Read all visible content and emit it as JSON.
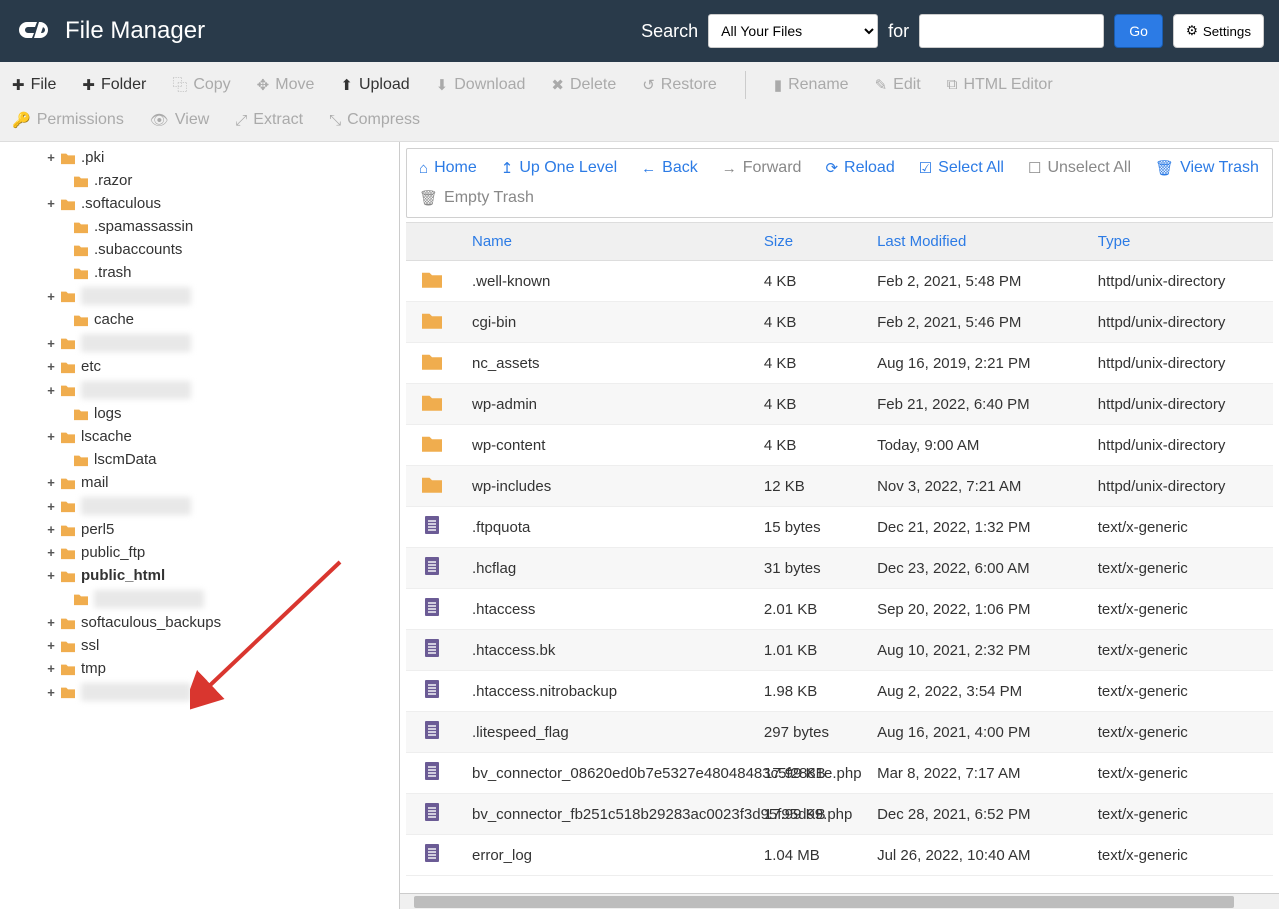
{
  "header": {
    "title": "File Manager",
    "search_label": "Search",
    "for_label": "for",
    "search_scope": "All Your Files",
    "go_label": "Go",
    "settings_label": "Settings"
  },
  "toolbar": {
    "file": "File",
    "folder": "Folder",
    "copy": "Copy",
    "move": "Move",
    "upload": "Upload",
    "download": "Download",
    "delete": "Delete",
    "restore": "Restore",
    "rename": "Rename",
    "edit": "Edit",
    "html_editor": "HTML Editor",
    "permissions": "Permissions",
    "view": "View",
    "extract": "Extract",
    "compress": "Compress"
  },
  "nav": {
    "home": "Home",
    "up": "Up One Level",
    "back": "Back",
    "forward": "Forward",
    "reload": "Reload",
    "select_all": "Select All",
    "unselect_all": "Unselect All",
    "view_trash": "View Trash",
    "empty_trash": "Empty Trash"
  },
  "tree": [
    {
      "toggle": "+",
      "label": ".pki",
      "level": 0
    },
    {
      "toggle": "",
      "label": ".razor",
      "level": 1
    },
    {
      "toggle": "+",
      "label": ".softaculous",
      "level": 0
    },
    {
      "toggle": "",
      "label": ".spamassassin",
      "level": 1
    },
    {
      "toggle": "",
      "label": ".subaccounts",
      "level": 1
    },
    {
      "toggle": "",
      "label": ".trash",
      "level": 1
    },
    {
      "toggle": "+",
      "label": "",
      "level": 0,
      "blurred": true
    },
    {
      "toggle": "",
      "label": "cache",
      "level": 1
    },
    {
      "toggle": "+",
      "label": "",
      "level": 0,
      "blurred": true
    },
    {
      "toggle": "+",
      "label": "etc",
      "level": 0
    },
    {
      "toggle": "+",
      "label": "",
      "level": 0,
      "blurred": true
    },
    {
      "toggle": "",
      "label": "logs",
      "level": 1
    },
    {
      "toggle": "+",
      "label": "lscache",
      "level": 0
    },
    {
      "toggle": "",
      "label": "lscmData",
      "level": 1
    },
    {
      "toggle": "+",
      "label": "mail",
      "level": 0
    },
    {
      "toggle": "+",
      "label": "",
      "level": 0,
      "blurred": true
    },
    {
      "toggle": "+",
      "label": "perl5",
      "level": 0
    },
    {
      "toggle": "+",
      "label": "public_ftp",
      "level": 0
    },
    {
      "toggle": "+",
      "label": "public_html",
      "level": 0,
      "bold": true
    },
    {
      "toggle": "",
      "label": "",
      "level": 1,
      "blurred": true
    },
    {
      "toggle": "+",
      "label": "softaculous_backups",
      "level": 0
    },
    {
      "toggle": "+",
      "label": "ssl",
      "level": 0
    },
    {
      "toggle": "+",
      "label": "tmp",
      "level": 0
    },
    {
      "toggle": "+",
      "label": "",
      "level": 0,
      "blurred": true
    }
  ],
  "columns": {
    "name": "Name",
    "size": "Size",
    "modified": "Last Modified",
    "type": "Type"
  },
  "files": [
    {
      "icon": "folder",
      "name": ".well-known",
      "size": "4 KB",
      "modified": "Feb 2, 2021, 5:48 PM",
      "type": "httpd/unix-directory"
    },
    {
      "icon": "folder",
      "name": "cgi-bin",
      "size": "4 KB",
      "modified": "Feb 2, 2021, 5:46 PM",
      "type": "httpd/unix-directory"
    },
    {
      "icon": "folder",
      "name": "nc_assets",
      "size": "4 KB",
      "modified": "Aug 16, 2019, 2:21 PM",
      "type": "httpd/unix-directory"
    },
    {
      "icon": "folder",
      "name": "wp-admin",
      "size": "4 KB",
      "modified": "Feb 21, 2022, 6:40 PM",
      "type": "httpd/unix-directory"
    },
    {
      "icon": "folder",
      "name": "wp-content",
      "size": "4 KB",
      "modified": "Today, 9:00 AM",
      "type": "httpd/unix-directory"
    },
    {
      "icon": "folder",
      "name": "wp-includes",
      "size": "12 KB",
      "modified": "Nov 3, 2022, 7:21 AM",
      "type": "httpd/unix-directory"
    },
    {
      "icon": "file",
      "name": ".ftpquota",
      "size": "15 bytes",
      "modified": "Dec 21, 2022, 1:32 PM",
      "type": "text/x-generic"
    },
    {
      "icon": "file",
      "name": ".hcflag",
      "size": "31 bytes",
      "modified": "Dec 23, 2022, 6:00 AM",
      "type": "text/x-generic"
    },
    {
      "icon": "file",
      "name": ".htaccess",
      "size": "2.01 KB",
      "modified": "Sep 20, 2022, 1:06 PM",
      "type": "text/x-generic"
    },
    {
      "icon": "file",
      "name": ".htaccess.bk",
      "size": "1.01 KB",
      "modified": "Aug 10, 2021, 2:32 PM",
      "type": "text/x-generic"
    },
    {
      "icon": "file",
      "name": ".htaccess.nitrobackup",
      "size": "1.98 KB",
      "modified": "Aug 2, 2022, 3:54 PM",
      "type": "text/x-generic"
    },
    {
      "icon": "file",
      "name": ".litespeed_flag",
      "size": "297 bytes",
      "modified": "Aug 16, 2021, 4:00 PM",
      "type": "text/x-generic"
    },
    {
      "icon": "file",
      "name": "bv_connector_08620ed0b7e5327e48048483c5f2881e.php",
      "size": "17.99 KB",
      "modified": "Mar 8, 2022, 7:17 AM",
      "type": "text/x-generic"
    },
    {
      "icon": "file",
      "name": "bv_connector_fb251c518b29283ac0023f3d95f95d99.php",
      "size": "17.99 KB",
      "modified": "Dec 28, 2021, 6:52 PM",
      "type": "text/x-generic"
    },
    {
      "icon": "file",
      "name": "error_log",
      "size": "1.04 MB",
      "modified": "Jul 26, 2022, 10:40 AM",
      "type": "text/x-generic"
    }
  ]
}
